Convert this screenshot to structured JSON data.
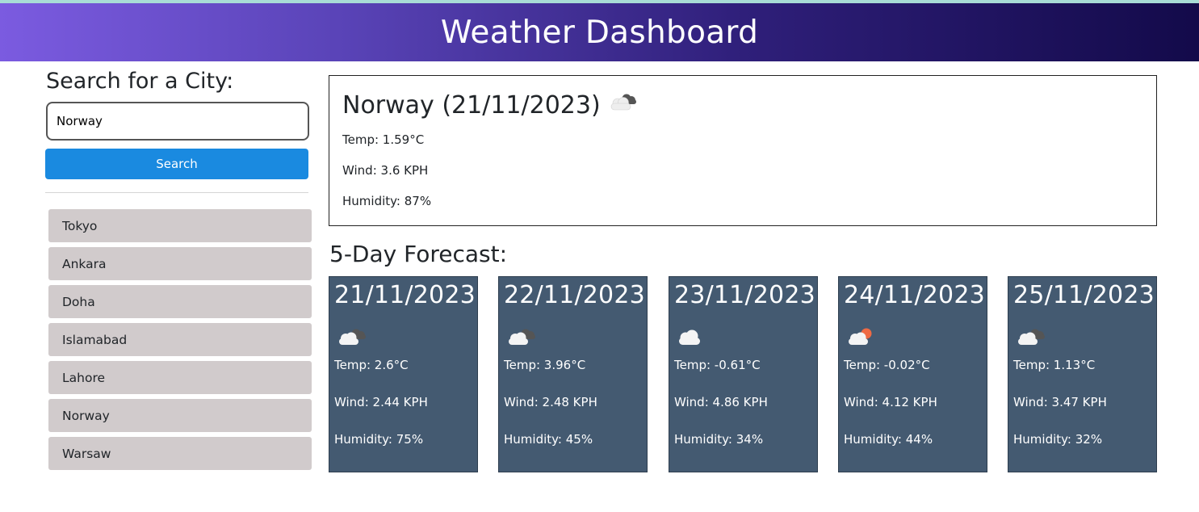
{
  "header": {
    "title": "Weather Dashboard"
  },
  "search": {
    "heading": "Search for a City:",
    "input_value": "Norway",
    "button_label": "Search"
  },
  "history": [
    "Tokyo",
    "Ankara",
    "Doha",
    "Islamabad",
    "Lahore",
    "Norway",
    "Warsaw"
  ],
  "current": {
    "title": "Norway (21/11/2023)",
    "icon": "broken-clouds-icon",
    "temp": "Temp: 1.59°C",
    "wind": "Wind: 3.6 KPH",
    "humidity": "Humidity: 87%"
  },
  "forecast": {
    "heading": "5-Day Forecast:",
    "days": [
      {
        "date": "21/11/2023",
        "icon": "broken-clouds-icon",
        "temp": "Temp: 2.6°C",
        "wind": "Wind: 2.44 KPH",
        "humidity": "Humidity: 75%"
      },
      {
        "date": "22/11/2023",
        "icon": "broken-clouds-icon",
        "temp": "Temp: 3.96°C",
        "wind": "Wind: 2.48 KPH",
        "humidity": "Humidity: 45%"
      },
      {
        "date": "23/11/2023",
        "icon": "cloud-icon",
        "temp": "Temp: -0.61°C",
        "wind": "Wind: 4.86 KPH",
        "humidity": "Humidity: 34%"
      },
      {
        "date": "24/11/2023",
        "icon": "partly-cloudy-icon",
        "temp": "Temp: -0.02°C",
        "wind": "Wind: 4.12 KPH",
        "humidity": "Humidity: 44%"
      },
      {
        "date": "25/11/2023",
        "icon": "broken-clouds-icon",
        "temp": "Temp: 1.13°C",
        "wind": "Wind: 3.47 KPH",
        "humidity": "Humidity: 32%"
      }
    ]
  },
  "colors": {
    "header_gradient_start": "#7b5be0",
    "header_gradient_end": "#130a4a",
    "search_button": "#1a8ae0",
    "history_item": "#d1cbcc",
    "forecast_card": "#445a71"
  }
}
